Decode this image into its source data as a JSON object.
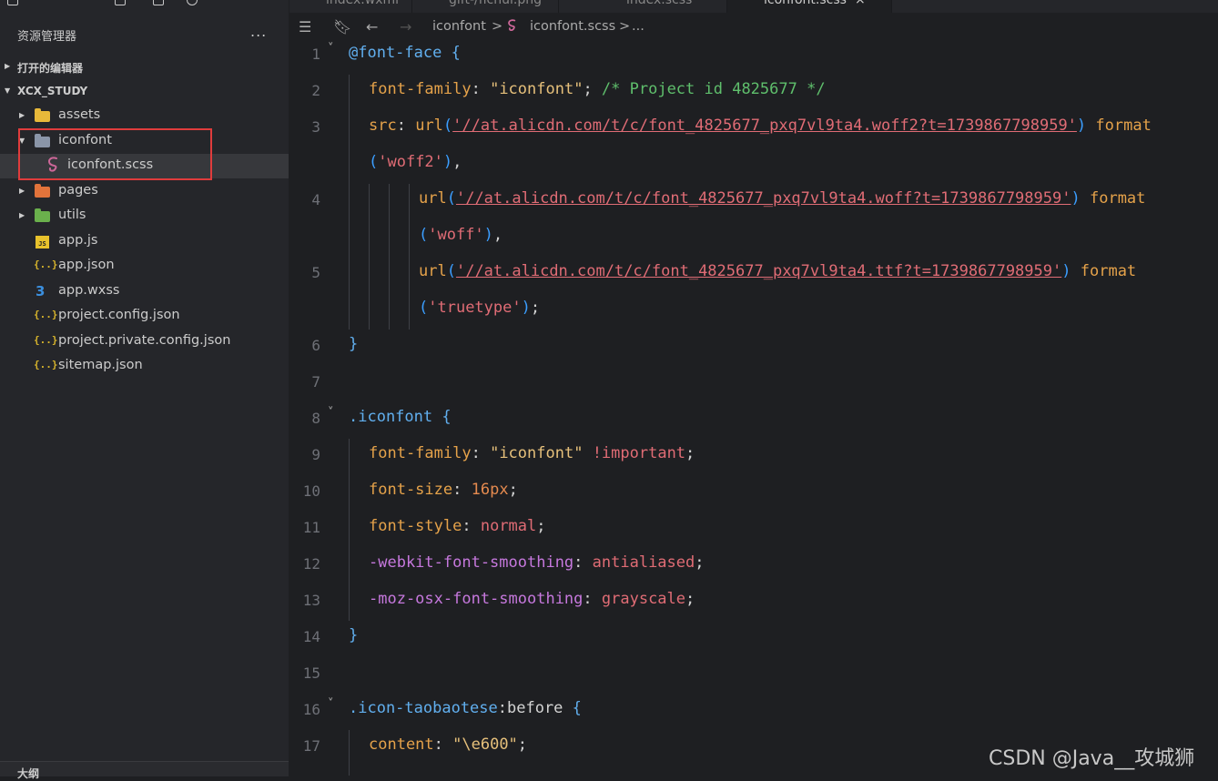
{
  "sidebar": {
    "title": "资源管理器",
    "more": "...",
    "sections": {
      "open_editors": "打开的编辑器",
      "project": "XCX_STUDY",
      "outline": "大纲"
    },
    "tree": [
      {
        "name": "assets",
        "type": "folder",
        "icon": "folder-yellow-icon",
        "color": "#e8b93a"
      },
      {
        "name": "iconfont",
        "type": "folder-open",
        "icon": "folder-open-icon",
        "color": "#8a95a8"
      },
      {
        "name": "iconfont.scss",
        "type": "file",
        "icon": "sass-icon",
        "color": "#cd6799"
      },
      {
        "name": "pages",
        "type": "folder",
        "icon": "folder-orange-icon",
        "color": "#e2733b"
      },
      {
        "name": "utils",
        "type": "folder",
        "icon": "folder-green-icon",
        "color": "#6ab04c"
      },
      {
        "name": "app.js",
        "type": "file",
        "icon": "js-icon"
      },
      {
        "name": "app.json",
        "type": "file",
        "icon": "json-icon"
      },
      {
        "name": "app.wxss",
        "type": "file",
        "icon": "css-icon"
      },
      {
        "name": "project.config.json",
        "type": "file",
        "icon": "json-icon"
      },
      {
        "name": "project.private.config.json",
        "type": "file",
        "icon": "json-icon"
      },
      {
        "name": "sitemap.json",
        "type": "file",
        "icon": "json-icon"
      }
    ]
  },
  "tabs": [
    {
      "label": "index.wxml"
    },
    {
      "label": "gift-/ficnul.png"
    },
    {
      "label": "index.scss"
    },
    {
      "label": "iconfont.scss",
      "active": true,
      "close": "×"
    }
  ],
  "breadcrumb": {
    "folder": "iconfont",
    "sep": ">",
    "file": "iconfont.scss",
    "more": "..."
  },
  "code": {
    "line_numbers": [
      "1",
      "2",
      "3",
      "",
      "4",
      "",
      "5",
      "",
      "6",
      "7",
      "8",
      "9",
      "10",
      "11",
      "12",
      "13",
      "14",
      "15",
      "16",
      "17"
    ],
    "l1_at": "@font-face",
    "l1_brace": " {",
    "l2_prop": "font-family",
    "l2_str": "\"iconfont\"",
    "l2_comment": "/* Project id 4825677 */",
    "l3_prop": "src",
    "url_fn": "url",
    "url1": "'//at.alicdn.com/t/c/font_4825677_pxq7vl9ta4.woff2?t=1739867798959'",
    "url2": "'//at.alicdn.com/t/c/font_4825677_pxq7vl9ta4.woff?t=1739867798959'",
    "url3": "'//at.alicdn.com/t/c/font_4825677_pxq7vl9ta4.ttf?t=1739867798959'",
    "format_fn": "format",
    "fmt1": "'woff2'",
    "fmt2": "'woff'",
    "fmt3": "'truetype'",
    "close_brace": "}",
    "sel_iconfont": ".iconfont",
    "l9_prop": "font-family",
    "l9_str": "\"iconfont\"",
    "l9_imp": "!important",
    "l10_prop": "font-size",
    "l10_val": "16px",
    "l11_prop": "font-style",
    "l11_val": "normal",
    "l12_prop": "-webkit-font-smoothing",
    "l12_val": "antialiased",
    "l13_prop": "-moz-osx-font-smoothing",
    "l13_val": "grayscale",
    "sel_tb": ".icon-taobaotese",
    "pseudo": ":before",
    "l17_prop": "content",
    "l17_str": "\"\\e600\""
  },
  "watermark": "CSDN @Java__攻城狮"
}
